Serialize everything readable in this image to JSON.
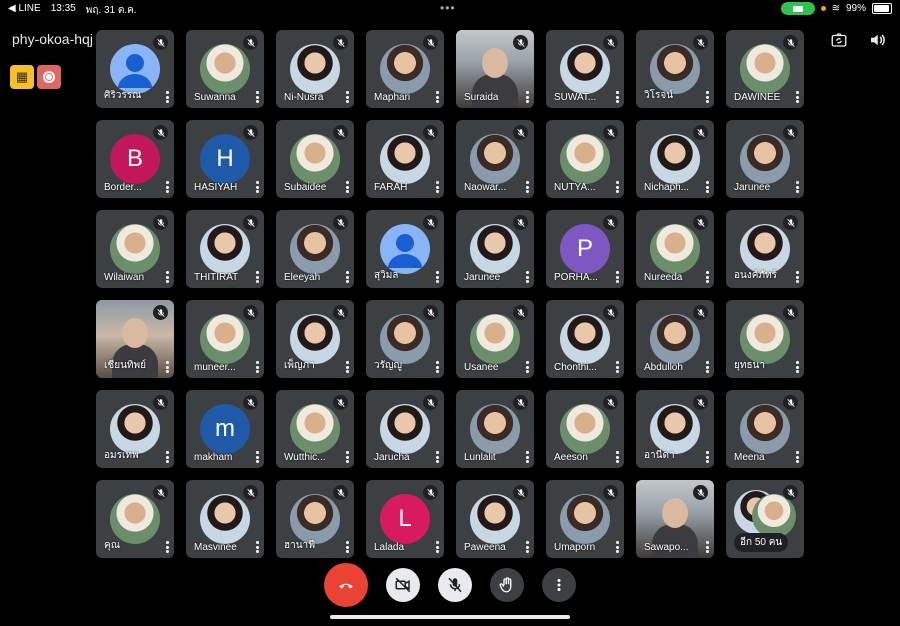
{
  "status_bar": {
    "back_app": "◀ LINE",
    "time": "13:35",
    "date": "พฤ. 31 ต.ค.",
    "battery": "99%"
  },
  "meeting": {
    "code": "phy-okoa-hqj"
  },
  "participants": [
    {
      "name": "ศิริวรรณ",
      "avatar": "default"
    },
    {
      "name": "Suwanna",
      "avatar": "photo"
    },
    {
      "name": "Ni-Nusra",
      "avatar": "photo"
    },
    {
      "name": "Maphari",
      "avatar": "photo"
    },
    {
      "name": "Suraida",
      "avatar": "full"
    },
    {
      "name": "SUWAT...",
      "avatar": "photo"
    },
    {
      "name": "วิโรจน์",
      "avatar": "photo"
    },
    {
      "name": "DAWINEE",
      "avatar": "photo"
    },
    {
      "name": "Border...",
      "avatar": "letter",
      "letter": "B",
      "color": "#c2185b"
    },
    {
      "name": "HASIYAH",
      "avatar": "letter",
      "letter": "H",
      "color": "#1e5aa8"
    },
    {
      "name": "Subaidee",
      "avatar": "photo"
    },
    {
      "name": "FARAH",
      "avatar": "photo"
    },
    {
      "name": "Naowar...",
      "avatar": "photo"
    },
    {
      "name": "NUTYA...",
      "avatar": "photo"
    },
    {
      "name": "Nichaph...",
      "avatar": "photo"
    },
    {
      "name": "Jarunee",
      "avatar": "photo"
    },
    {
      "name": "Wilaiwan",
      "avatar": "photo"
    },
    {
      "name": "THITIRAT",
      "avatar": "photo"
    },
    {
      "name": "Eleeyah",
      "avatar": "photo"
    },
    {
      "name": "สุวิมล",
      "avatar": "default"
    },
    {
      "name": "Jarunee",
      "avatar": "photo"
    },
    {
      "name": "PORHA...",
      "avatar": "letter",
      "letter": "P",
      "color": "#7e57c2"
    },
    {
      "name": "Nureeda",
      "avatar": "photo"
    },
    {
      "name": "อนงค์ภัทร์",
      "avatar": "photo"
    },
    {
      "name": "เชียนทิพย์",
      "avatar": "full"
    },
    {
      "name": "muneer...",
      "avatar": "photo"
    },
    {
      "name": "เพ็ญภา",
      "avatar": "photo"
    },
    {
      "name": "วรัญญู",
      "avatar": "photo"
    },
    {
      "name": "Usanee",
      "avatar": "photo"
    },
    {
      "name": "Chonthi...",
      "avatar": "photo"
    },
    {
      "name": "Abdulloh",
      "avatar": "photo"
    },
    {
      "name": "ยุทธนา",
      "avatar": "photo"
    },
    {
      "name": "อมรเทพ",
      "avatar": "photo"
    },
    {
      "name": "makham",
      "avatar": "letter",
      "letter": "m",
      "color": "#1e5aa8"
    },
    {
      "name": "Wutthic...",
      "avatar": "photo"
    },
    {
      "name": "Jarucha",
      "avatar": "photo"
    },
    {
      "name": "Lunlalit",
      "avatar": "photo"
    },
    {
      "name": "Aeeson",
      "avatar": "photo"
    },
    {
      "name": "อานีดา",
      "avatar": "photo"
    },
    {
      "name": "Meena",
      "avatar": "photo"
    },
    {
      "name": "คุณ",
      "avatar": "photo"
    },
    {
      "name": "Masvinee",
      "avatar": "photo"
    },
    {
      "name": "ฮานาฟี",
      "avatar": "photo"
    },
    {
      "name": "Lalada",
      "avatar": "letter",
      "letter": "L",
      "color": "#d81b60"
    },
    {
      "name": "Paweena",
      "avatar": "photo"
    },
    {
      "name": "Umaporn",
      "avatar": "photo"
    },
    {
      "name": "Sawapo...",
      "avatar": "full"
    },
    {
      "name": "อีก 50 คน",
      "avatar": "others"
    }
  ],
  "controls": [
    {
      "name": "end-call-button",
      "icon": "phone-hangup-icon",
      "style": "end"
    },
    {
      "name": "camera-toggle-button",
      "icon": "camera-off-icon",
      "style": "light"
    },
    {
      "name": "mic-toggle-button",
      "icon": "mic-off-icon",
      "style": "light"
    },
    {
      "name": "raise-hand-button",
      "icon": "hand-icon",
      "style": "dark"
    },
    {
      "name": "more-options-button",
      "icon": "more-vert-icon",
      "style": "dark"
    }
  ],
  "colors": {
    "tile": "#3c4043",
    "background": "#000000",
    "end_call": "#ea4335",
    "muted_badge": "#202124"
  }
}
